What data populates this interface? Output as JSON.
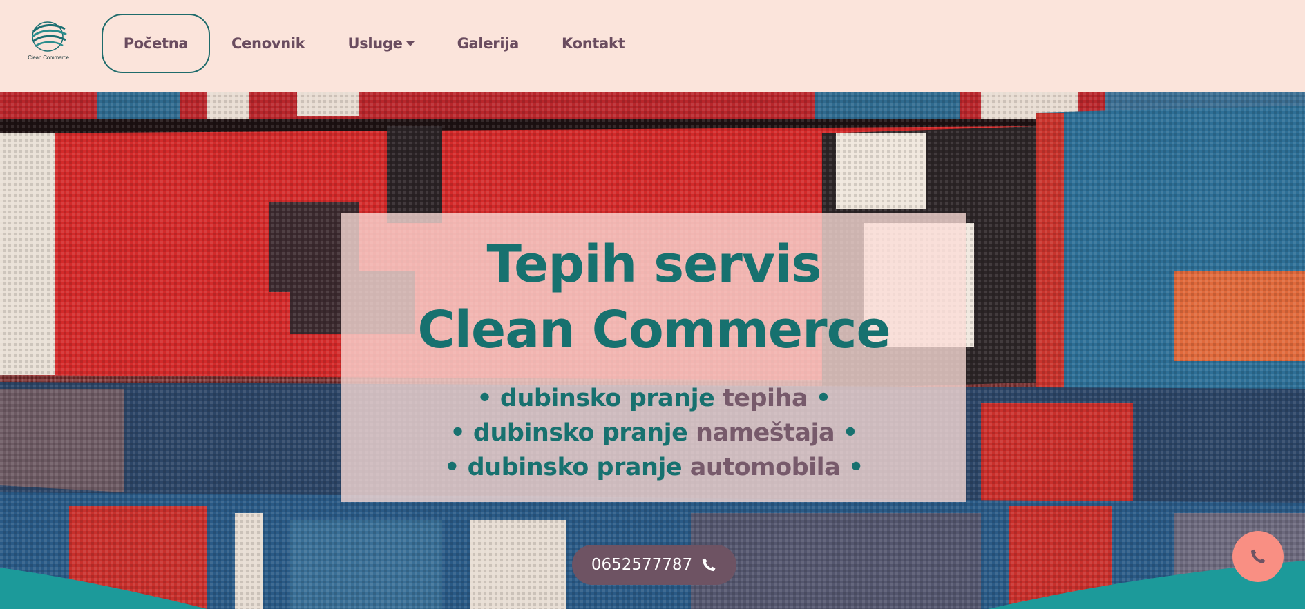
{
  "logo": {
    "text": "Clean Commerce",
    "icon": "globe-swirl-logo-icon"
  },
  "nav": {
    "items": [
      {
        "label": "Početna",
        "active": true
      },
      {
        "label": "Cenovnik",
        "active": false
      },
      {
        "label": "Usluge",
        "active": false,
        "has_dropdown": true
      },
      {
        "label": "Galerija",
        "active": false
      },
      {
        "label": "Kontakt",
        "active": false
      }
    ]
  },
  "hero": {
    "title_line1": "Tepih servis",
    "title_line2": "Clean Commerce",
    "services": [
      {
        "prefix": "• dubinsko pranje ",
        "object": "tepiha",
        "suffix": " •"
      },
      {
        "prefix": "• dubinsko pranje ",
        "object": "nameštaja",
        "suffix": " •"
      },
      {
        "prefix": "• dubinsko pranje ",
        "object": "automobila",
        "suffix": " •"
      }
    ]
  },
  "contact": {
    "phone": "0652577787",
    "phone_icon": "phone-icon",
    "call_button_icon": "phone-icon"
  },
  "colors": {
    "header_bg": "#fbe4db",
    "nav_text": "#6a4c5f",
    "accent_teal": "#17716f",
    "accent_mauve": "#775a6b",
    "pill_bg": "#6e5363",
    "fab_bg": "#f98f83",
    "wave": "#1c9a9a"
  }
}
